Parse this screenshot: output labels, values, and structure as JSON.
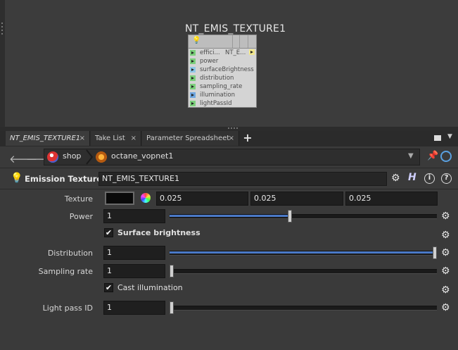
{
  "network": {
    "node_title": "NT_EMIS_TEXTURE1",
    "node_output_label": "NT_E...",
    "node_inputs": [
      {
        "label": "effici...",
        "color": "#7ccf7c"
      },
      {
        "label": "power",
        "color": "#7ccf7c"
      },
      {
        "label": "surfaceBrightness",
        "color": "#8ec8e8"
      },
      {
        "label": "distribution",
        "color": "#7ccf7c"
      },
      {
        "label": "sampling_rate",
        "color": "#7ccf7c"
      },
      {
        "label": "illumination",
        "color": "#6fa6e0"
      },
      {
        "label": "lightPassId",
        "color": "#7ccf7c"
      }
    ]
  },
  "tabs": [
    {
      "label": "NT_EMIS_TEXTURE1",
      "close": "×"
    },
    {
      "label": "Take List",
      "close": "×"
    },
    {
      "label": "Parameter Spreadsheet",
      "close": "×"
    }
  ],
  "tab_add": "+",
  "path": {
    "back_icon": "left-arrow-icon",
    "forward_icon": "right-arrow-icon",
    "crumbs": [
      "shop",
      "octane_vopnet1"
    ]
  },
  "header": {
    "type_label": "Emission Texture",
    "node_name": "NT_EMIS_TEXTURE1",
    "h_label": "H",
    "info_label": "i",
    "help_label": "?"
  },
  "params": {
    "texture": {
      "label": "Texture",
      "values": [
        "0.025",
        "0.025",
        "0.025"
      ],
      "swatch_color": "#0a0a0a"
    },
    "power": {
      "label": "Power",
      "value": "1",
      "slider_fraction": 0.45
    },
    "surface_brightness": {
      "label": "Surface brightness",
      "checked": true,
      "check_glyph": "✔"
    },
    "distribution": {
      "label": "Distribution",
      "value": "1",
      "slider_fraction": 1.0
    },
    "sampling_rate": {
      "label": "Sampling rate",
      "value": "1",
      "slider_fraction": 0.0
    },
    "cast_illumination": {
      "label": "Cast illumination",
      "checked": true,
      "check_glyph": "✔"
    },
    "light_pass_id": {
      "label": "Light pass ID",
      "value": "1",
      "slider_fraction": 0.0
    }
  },
  "colors": {
    "accent": "#4a79c7",
    "background": "#3a3a3a",
    "field": "#1f1f1f"
  }
}
